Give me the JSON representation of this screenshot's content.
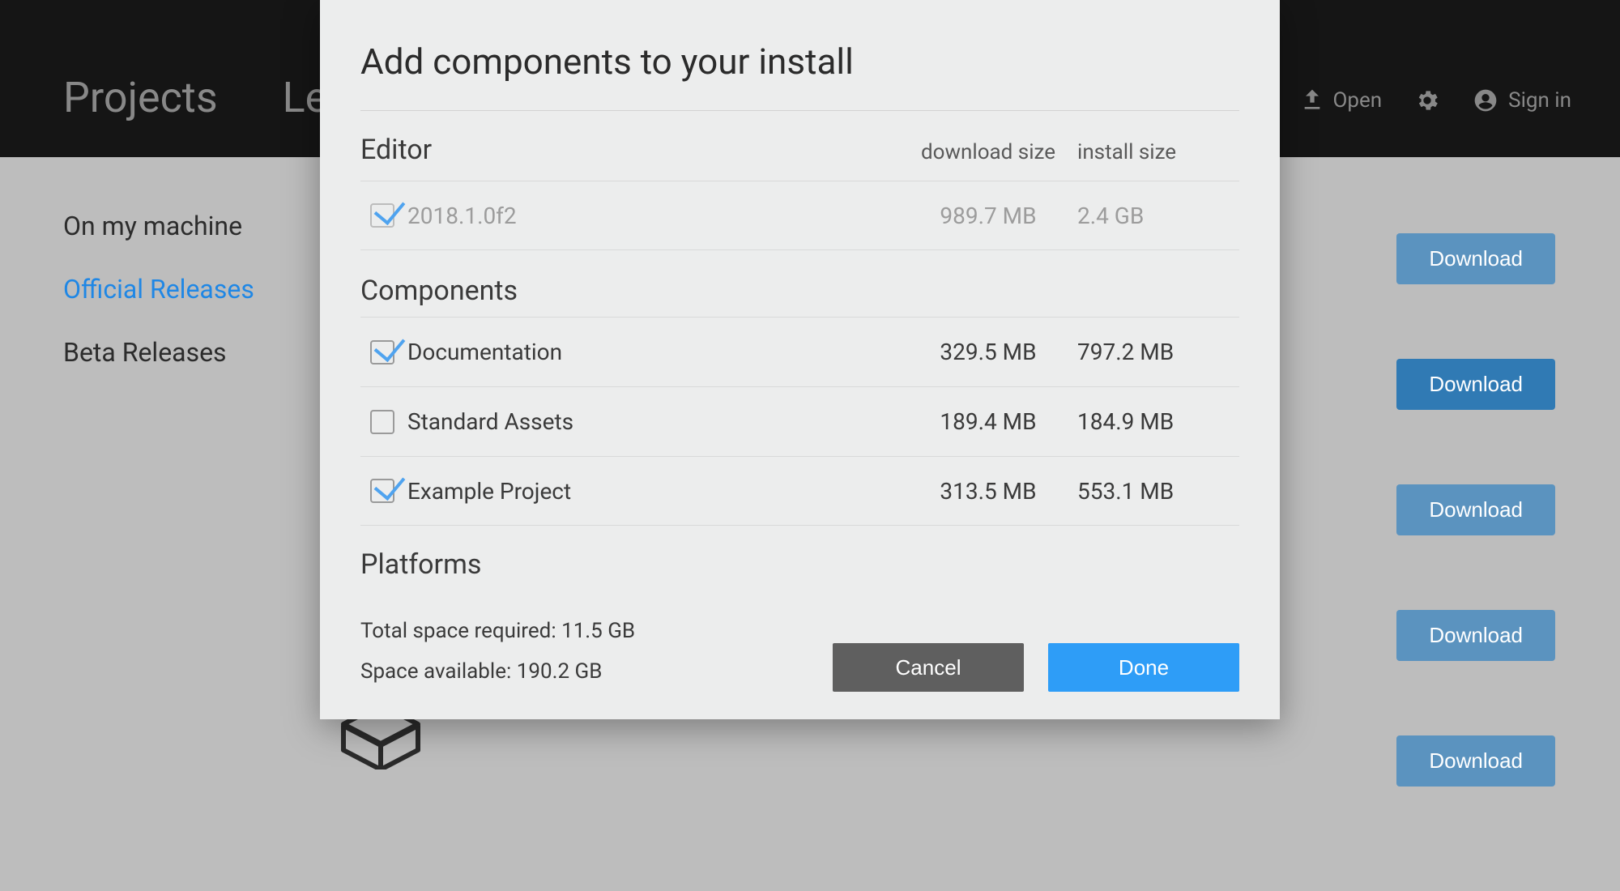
{
  "header": {
    "tabs": [
      "Projects",
      "Learn"
    ],
    "open": "Open",
    "signin": "Sign in"
  },
  "sidebar": {
    "items": [
      "On my machine",
      "Official Releases",
      "Beta Releases"
    ],
    "selected_index": 1
  },
  "download_button_label": "Download",
  "modal": {
    "title": "Add components to your install",
    "col_download": "download size",
    "col_install": "install size",
    "editor_heading": "Editor",
    "editor": {
      "name": "2018.1.0f2",
      "download": "989.7 MB",
      "install": "2.4 GB",
      "checked": true,
      "locked": true
    },
    "components_heading": "Components",
    "components": [
      {
        "name": "Documentation",
        "download": "329.5 MB",
        "install": "797.2 MB",
        "checked": true
      },
      {
        "name": "Standard Assets",
        "download": "189.4 MB",
        "install": "184.9 MB",
        "checked": false
      },
      {
        "name": "Example Project",
        "download": "313.5 MB",
        "install": "553.1 MB",
        "checked": true
      }
    ],
    "platforms_heading": "Platforms",
    "total_label": "Total space required: ",
    "total_value": "11.5 GB",
    "avail_label": "Space available: ",
    "avail_value": "190.2 GB",
    "cancel": "Cancel",
    "done": "Done"
  }
}
